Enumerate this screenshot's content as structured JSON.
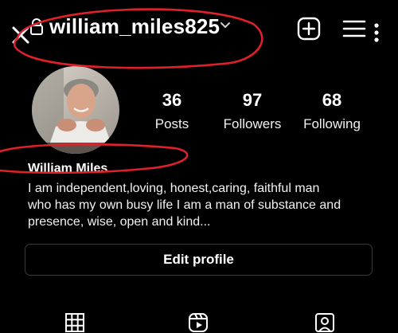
{
  "header": {
    "username": "william_miles825"
  },
  "stats": [
    {
      "value": "36",
      "label": "Posts"
    },
    {
      "value": "97",
      "label": "Followers"
    },
    {
      "value": "68",
      "label": "Following"
    }
  ],
  "profile": {
    "name": "William Miles",
    "bio_lines": [
      "I am independent,loving, honest,caring, faithful man",
      "who has my own busy life I am a man of substance and",
      "presence, wise, open and kind..."
    ]
  },
  "actions": {
    "edit_profile_label": "Edit profile"
  },
  "icons": {
    "close": "close-icon",
    "lock": "lock-icon",
    "dropdown": "chevron-down-icon",
    "create": "plus-square-icon",
    "menu": "hamburger-menu-icon",
    "more": "more-vertical-icon",
    "grid": "grid-icon",
    "reels": "reels-icon",
    "tagged": "tagged-icon"
  },
  "colors": {
    "background": "#000000",
    "text": "#ffffff",
    "button_border": "#3a3a3a",
    "annotation": "#e0202a"
  }
}
